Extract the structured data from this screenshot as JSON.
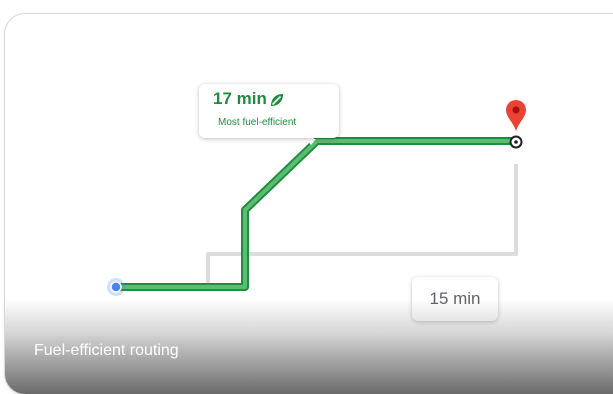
{
  "fast_route": {
    "time_label": "17 min",
    "badge_label": "Most fuel-efficient",
    "leaf_icon": "leaf-icon",
    "color": "#34a853"
  },
  "alt_route": {
    "time_label": "15 min",
    "color": "#dadce0"
  },
  "origin": {
    "icon": "origin-dot-icon",
    "color": "#4285f4"
  },
  "destination": {
    "icon": "map-pin-icon",
    "color": "#ea4335"
  },
  "caption": "Fuel-efficient routing"
}
